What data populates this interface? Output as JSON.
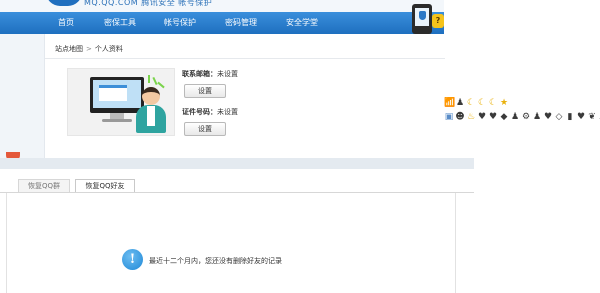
{
  "top_window": {
    "logo_text": "MQ.QQ.COM 腾讯安全 帐号保护",
    "nav": [
      "首页",
      "密保工具",
      "帐号保护",
      "密码管理",
      "安全学堂"
    ],
    "help_badge": "?",
    "breadcrumb": [
      "站点地图",
      "个人资料"
    ],
    "breadcrumb_sep": ">",
    "email": {
      "label": "联系邮箱：",
      "value": "未设置",
      "button": "设置"
    },
    "id_number": {
      "label": "证件号码：",
      "value": "未设置",
      "button": "设置"
    }
  },
  "emoji_strip": {
    "row1": [
      {
        "icon": "level-bars-icon",
        "glyph": "📶",
        "tone": "grey"
      },
      {
        "icon": "silhouette-icon",
        "glyph": "♟",
        "tone": "dark"
      },
      {
        "icon": "moon-icon",
        "glyph": "☾",
        "tone": "gold"
      },
      {
        "icon": "moon-icon",
        "glyph": "☾",
        "tone": "gold"
      },
      {
        "icon": "moon-icon",
        "glyph": "☾",
        "tone": "gold"
      },
      {
        "icon": "star-icon",
        "glyph": "★",
        "tone": "gold"
      }
    ],
    "row2": [
      {
        "icon": "photo-icon",
        "glyph": "▣",
        "tone": "blue"
      },
      {
        "icon": "avatar-icon",
        "glyph": "☻",
        "tone": "dark"
      },
      {
        "icon": "fire-icon",
        "glyph": "♨",
        "tone": "gold"
      },
      {
        "icon": "heart-icon",
        "glyph": "♥",
        "tone": "dark"
      },
      {
        "icon": "heart-icon",
        "glyph": "♥",
        "tone": "dark"
      },
      {
        "icon": "bag-icon",
        "glyph": "◆",
        "tone": "dark"
      },
      {
        "icon": "silhouette-icon",
        "glyph": "♟",
        "tone": "dark"
      },
      {
        "icon": "gear-icon",
        "glyph": "⚙",
        "tone": "dark"
      },
      {
        "icon": "silhouette-icon",
        "glyph": "♟",
        "tone": "dark"
      },
      {
        "icon": "heart-icon",
        "glyph": "♥",
        "tone": "dark"
      },
      {
        "icon": "gem-icon",
        "glyph": "◇",
        "tone": "dark"
      },
      {
        "icon": "badge-icon",
        "glyph": "▮",
        "tone": "dark"
      },
      {
        "icon": "heart-icon",
        "glyph": "♥",
        "tone": "dark"
      },
      {
        "icon": "bird-icon",
        "glyph": "❦",
        "tone": "dark"
      },
      {
        "icon": "cloud-icon",
        "glyph": "☁",
        "tone": "grey"
      },
      {
        "icon": "chevron-right-icon",
        "glyph": "›",
        "tone": "grey"
      }
    ]
  },
  "bottom_window": {
    "tabs": [
      "恢复QQ群",
      "恢复QQ好友"
    ],
    "message": "最近十二个月内，您还没有删除好友的记录",
    "info_glyph": "!"
  }
}
